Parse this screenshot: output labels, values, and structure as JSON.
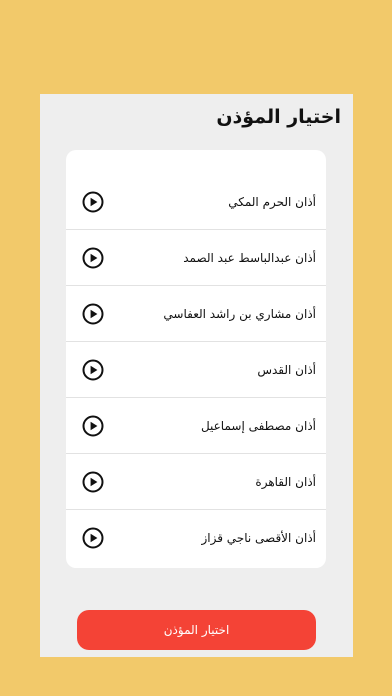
{
  "page": {
    "title": "اختيار المؤذن"
  },
  "muezzins": [
    {
      "label": "أذان الحرم المكي",
      "icon": "play-circle-icon"
    },
    {
      "label": "أذان عبدالباسط عبد الصمد",
      "icon": "play-circle-icon"
    },
    {
      "label": "أذان مشاري بن راشد العفاسي",
      "icon": "play-circle-icon"
    },
    {
      "label": "أذان القدس",
      "icon": "play-circle-icon"
    },
    {
      "label": "أذان مصطفى إسماعيل",
      "icon": "play-circle-icon"
    },
    {
      "label": "أذان القاهرة",
      "icon": "play-circle-icon"
    },
    {
      "label": "أذان الأقصى ناجي قزاز",
      "icon": "play-circle-icon"
    }
  ],
  "actions": {
    "choose_label": "اختيار المؤذن"
  },
  "colors": {
    "background": "#F2C96A",
    "sheet": "#EEEEEE",
    "button": "#F44336"
  }
}
